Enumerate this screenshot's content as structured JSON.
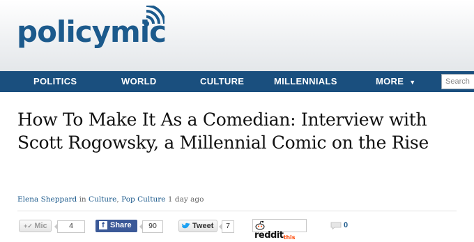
{
  "header": {
    "logo_text": "policymic",
    "brand_color": "#1c5a8c"
  },
  "nav": {
    "items": [
      {
        "label": "POLITICS"
      },
      {
        "label": "WORLD"
      },
      {
        "label": "CULTURE"
      },
      {
        "label": "MILLENNIALS"
      },
      {
        "label": "MORE"
      }
    ],
    "more_caret": "▼",
    "search_placeholder": "Search",
    "bar_color": "#1a4f7e"
  },
  "article": {
    "title": "How To Make It As a Comedian: Interview with Scott Rogowsky, a Millennial Comic on the Rise",
    "author": "Elena Sheppard",
    "in_text": "in",
    "category1": "Culture",
    "category_sep": ",",
    "category2": "Pop Culture",
    "time": "1 day ago"
  },
  "social": {
    "mic_label": "Mic",
    "mic_count": "4",
    "fb_label": "Share",
    "fb_icon": "f",
    "fb_count": "90",
    "tweet_label": "Tweet",
    "tweet_count": "7",
    "reddit_label": "reddit",
    "reddit_suffix": "this",
    "comment_count": "0",
    "colors": {
      "facebook": "#3b5998",
      "twitter": "#1da1f2",
      "reddit": "#ff4500"
    }
  }
}
